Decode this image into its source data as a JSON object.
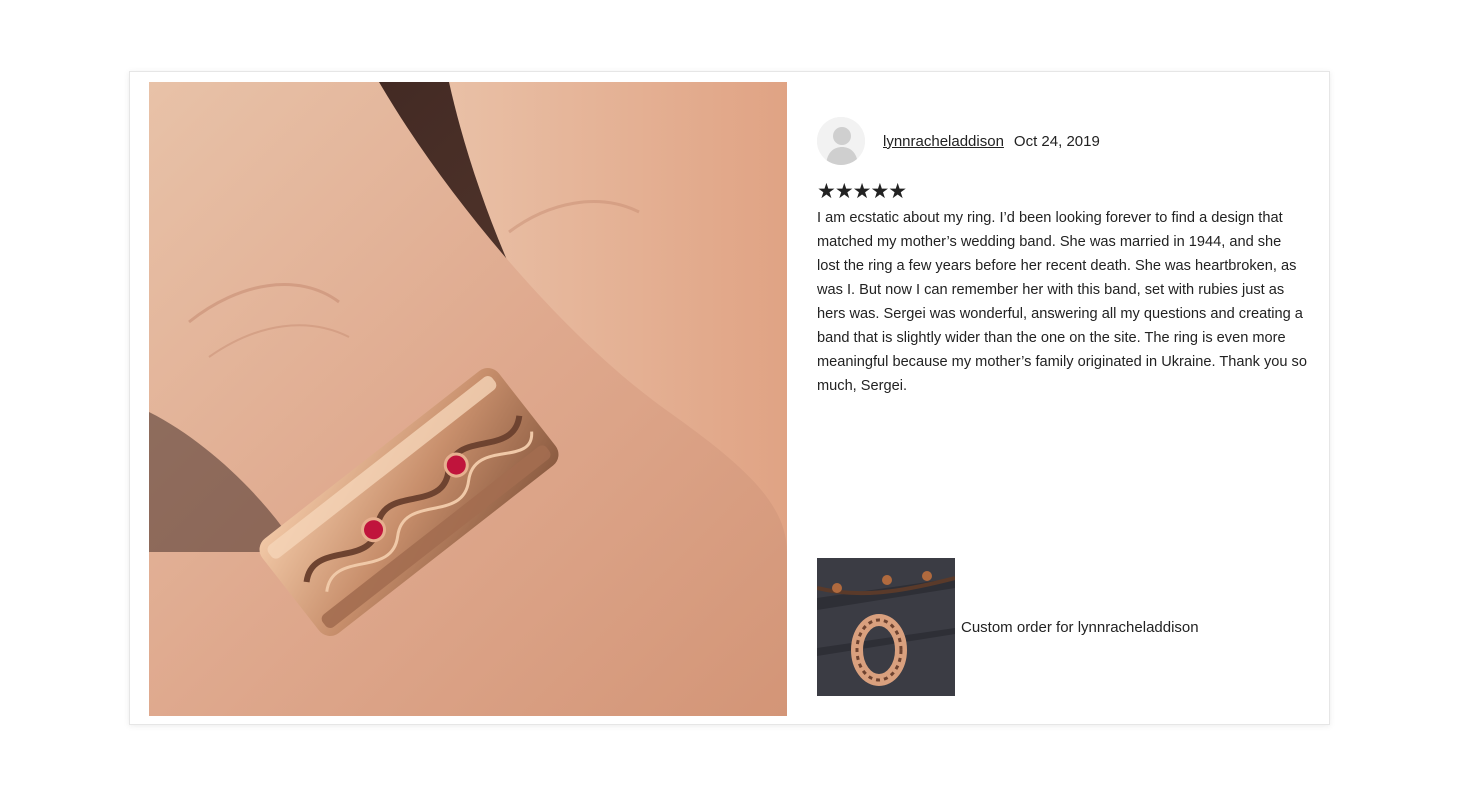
{
  "review": {
    "username": "lynnracheladdison",
    "date": "Oct 24, 2019",
    "rating": 5,
    "stars_text": "★★★★★",
    "text": "I am ecstatic about my ring. I’d been looking forever to find a design that matched my mother’s wedding band. She was married in 1944, and she lost the ring a few years before her recent death. She was heartbroken, as was I. But now I can remember her with this band, set with rubies just as hers was. Sergei was wonderful, answering all my questions and creating a band that is slightly wider than the one on the site. The ring is even more meaningful because my mother’s family originated in Ukraine. Thank you so much, Sergei."
  },
  "item": {
    "label": "Custom order for lynnracheladdison"
  },
  "colors": {
    "text": "#222222",
    "ruby": "#c0143c",
    "rose_gold": "#d9a07e"
  }
}
